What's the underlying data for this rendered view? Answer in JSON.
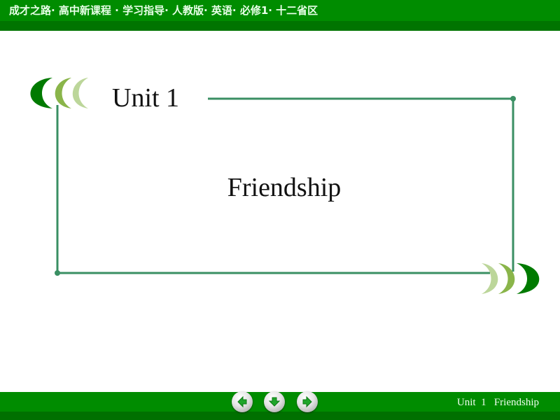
{
  "header": {
    "title": "成才之路· 高中新课程 · 学习指导· 人教版· 英语· 必修1· 十二省区"
  },
  "slide": {
    "unit_label": "Unit 1",
    "title": "Friendship"
  },
  "footer": {
    "text": "Unit  1   Friendship",
    "nav": [
      {
        "name": "previous",
        "icon": "arrow-left-icon"
      },
      {
        "name": "home",
        "icon": "arrow-down-icon"
      },
      {
        "name": "next",
        "icon": "arrow-right-icon"
      }
    ]
  },
  "colors": {
    "bar_green": "#008c00",
    "bar_dark_green": "#007400",
    "frame_line": "#3a8f63",
    "leaf_dark": "#007a00",
    "leaf_mid": "#8ab54a",
    "leaf_light": "#bcd69a",
    "nav_arrow": "#1fa52a"
  }
}
